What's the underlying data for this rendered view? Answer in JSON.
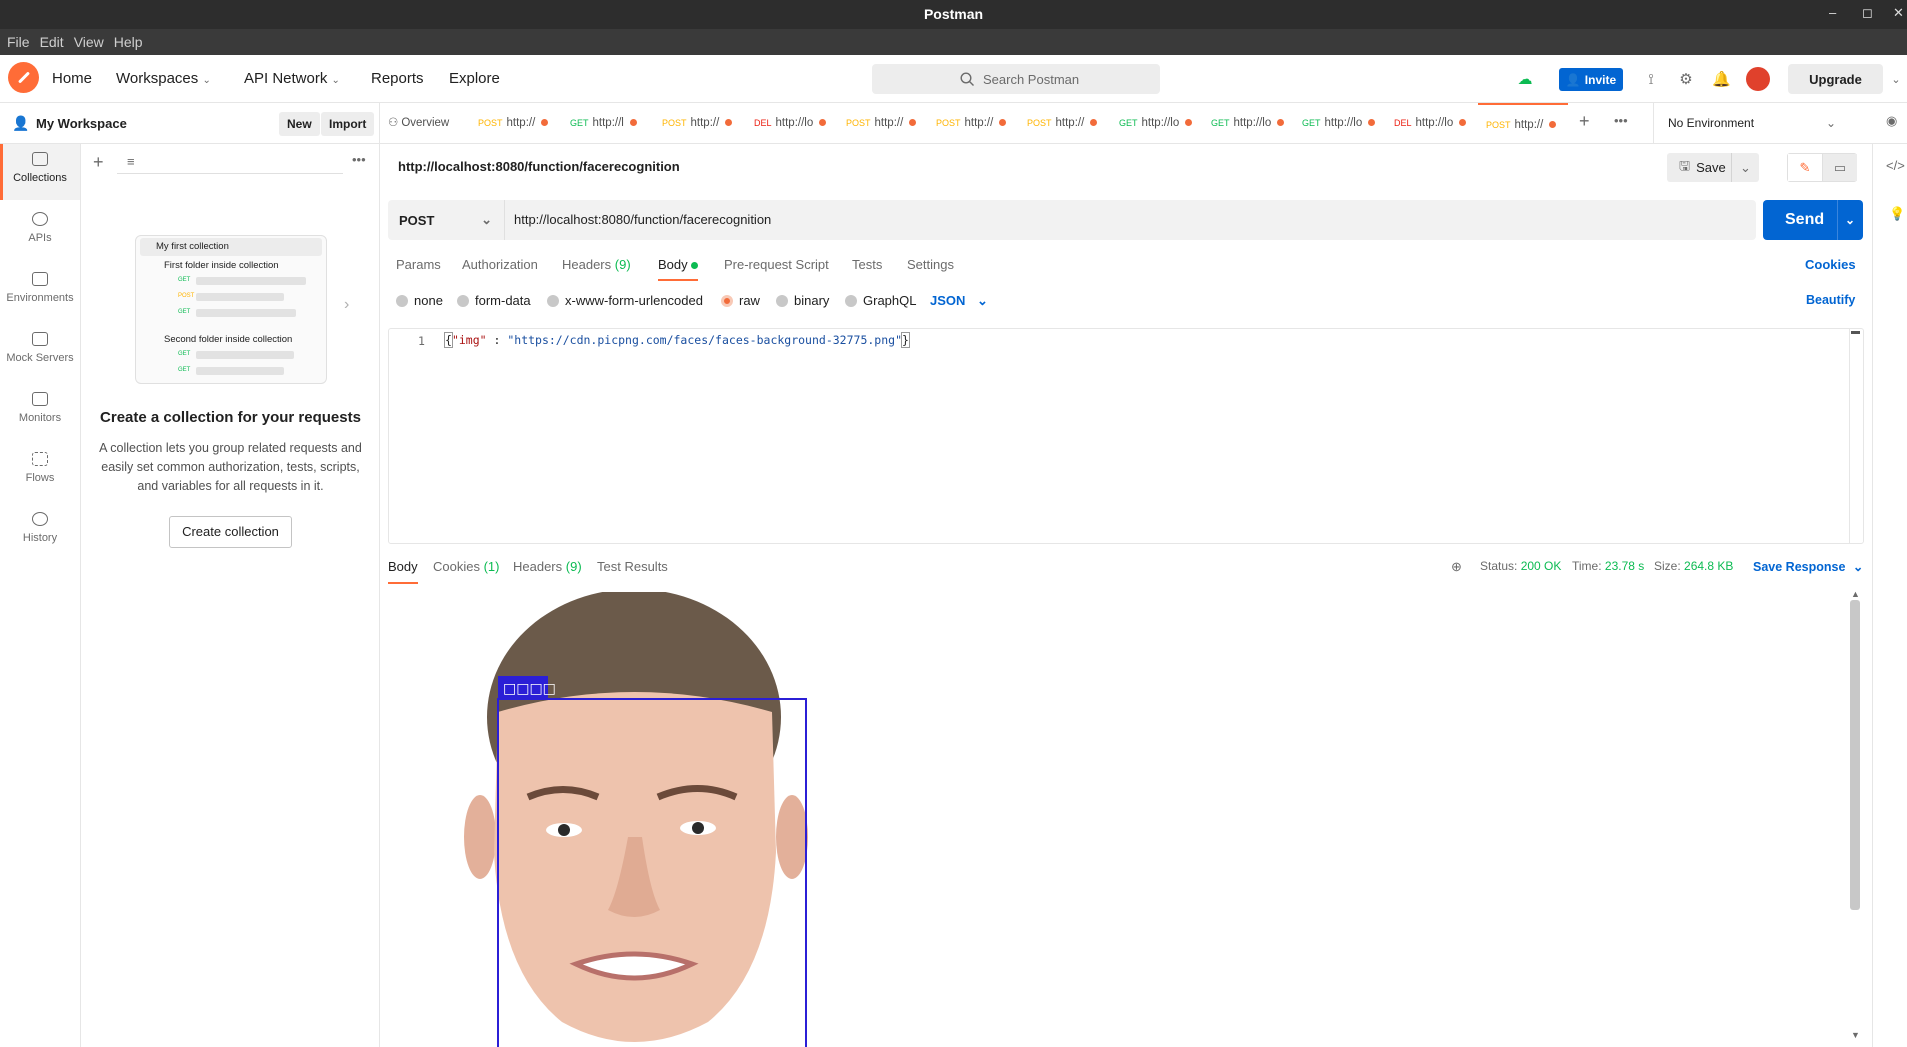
{
  "os": {
    "title": "Postman",
    "menu": [
      "File",
      "Edit",
      "View",
      "Help"
    ]
  },
  "header": {
    "nav": [
      "Home",
      "Workspaces",
      "API Network",
      "Reports",
      "Explore"
    ],
    "search_placeholder": "Search Postman",
    "invite_label": "Invite",
    "upgrade_label": "Upgrade"
  },
  "workspace": {
    "name": "My Workspace",
    "new_label": "New",
    "import_label": "Import"
  },
  "rail": [
    {
      "label": "Collections",
      "icon": "collections-icon"
    },
    {
      "label": "APIs",
      "icon": "apis-icon"
    },
    {
      "label": "Environments",
      "icon": "environments-icon"
    },
    {
      "label": "Mock Servers",
      "icon": "mock-servers-icon"
    },
    {
      "label": "Monitors",
      "icon": "monitors-icon"
    },
    {
      "label": "Flows",
      "icon": "flows-icon"
    },
    {
      "label": "History",
      "icon": "history-icon"
    }
  ],
  "illustration": {
    "collection": "My first collection",
    "folder1": "First folder inside collection",
    "folder2": "Second folder inside collection",
    "methods": [
      "GET",
      "POST",
      "GET",
      "GET",
      "GET"
    ]
  },
  "empty_state": {
    "title": "Create a collection for your requests",
    "description": "A collection lets you group related requests and easily set common authorization, tests, scripts, and variables for all requests in it.",
    "button": "Create collection"
  },
  "tabs": [
    {
      "method": "",
      "label": "Overview"
    },
    {
      "method": "POST",
      "label": "http://"
    },
    {
      "method": "GET",
      "label": "http://l"
    },
    {
      "method": "POST",
      "label": "http://"
    },
    {
      "method": "DEL",
      "label": "http://lo"
    },
    {
      "method": "POST",
      "label": "http://"
    },
    {
      "method": "POST",
      "label": "http://"
    },
    {
      "method": "POST",
      "label": "http://"
    },
    {
      "method": "GET",
      "label": "http://lo"
    },
    {
      "method": "GET",
      "label": "http://lo"
    },
    {
      "method": "GET",
      "label": "http://lo"
    },
    {
      "method": "DEL",
      "label": "http://lo"
    },
    {
      "method": "POST",
      "label": "http://"
    }
  ],
  "environment": "No Environment",
  "request": {
    "title": "http://localhost:8080/function/facerecognition",
    "save_label": "Save",
    "method": "POST",
    "url": "http://localhost:8080/function/facerecognition",
    "send_label": "Send",
    "subtabs": [
      "Params",
      "Authorization",
      "Headers",
      "Body",
      "Pre-request Script",
      "Tests",
      "Settings"
    ],
    "headers_count": "(9)",
    "cookies_label": "Cookies",
    "body_types": [
      "none",
      "form-data",
      "x-www-form-urlencoded",
      "raw",
      "binary",
      "GraphQL"
    ],
    "body_format": "JSON",
    "beautify_label": "Beautify",
    "line_number": "1",
    "code": {
      "open": "{",
      "key": "\"img\"",
      "sep": " : ",
      "value": "\"https://cdn.picpng.com/faces/faces-background-32775.png\"",
      "close": "}"
    }
  },
  "response": {
    "tabs": [
      "Body",
      "Cookies",
      "Headers",
      "Test Results"
    ],
    "cookies_count": "(1)",
    "headers_count": "(9)",
    "status_label": "Status:",
    "status_value": "200 OK",
    "time_label": "Time:",
    "time_value": "23.78 s",
    "size_label": "Size:",
    "size_value": "264.8 KB",
    "save_response_label": "Save Response",
    "face_box_label": "□□□□"
  },
  "colors": {
    "brand": "#ff6c37",
    "primary": "#0265d2",
    "post": "#ffb400",
    "get": "#0cbb52",
    "del": "#eb2013",
    "box": "#2b1fd6"
  }
}
